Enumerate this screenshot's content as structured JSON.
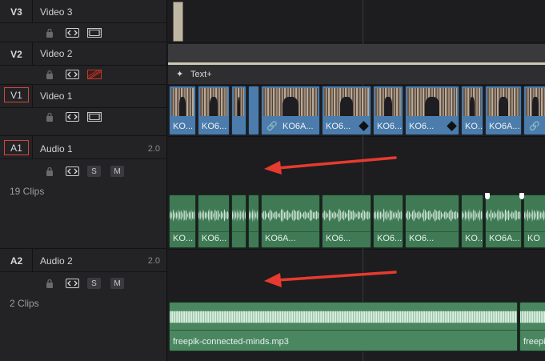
{
  "tracks": {
    "v3": {
      "id": "V3",
      "name": "Video 3"
    },
    "v2": {
      "id": "V2",
      "name": "Video 2"
    },
    "v1": {
      "id": "V1",
      "name": "Video 1"
    },
    "a1": {
      "id": "A1",
      "name": "Audio 1",
      "channels": "2.0",
      "clips_count": "19 Clips"
    },
    "a2": {
      "id": "A2",
      "name": "Audio 2",
      "channels": "2.0",
      "clips_count": "2 Clips"
    }
  },
  "buttons": {
    "solo": "S",
    "mute": "M"
  },
  "v2_clip": {
    "label": "Text+"
  },
  "v1_clips": [
    "KO...",
    "KO6...",
    "",
    "",
    "KO6A...",
    "KO6...",
    "KO6...",
    "KO6...",
    "KO...",
    "KO6A...",
    ""
  ],
  "a1_clips": [
    "KO...",
    "KO6...",
    "",
    "",
    "KO6A...",
    "KO6...",
    "KO6...",
    "KO6...",
    "KO...",
    "KO6A...",
    "KO"
  ],
  "a2_clips": [
    "freepik-connected-minds.mp3",
    "freepik"
  ],
  "colors": {
    "video_clip": "#4b7cab",
    "audio_clip": "#3f7a55",
    "arrow": "#e63b2e",
    "selected_outline": "#d0473d"
  }
}
